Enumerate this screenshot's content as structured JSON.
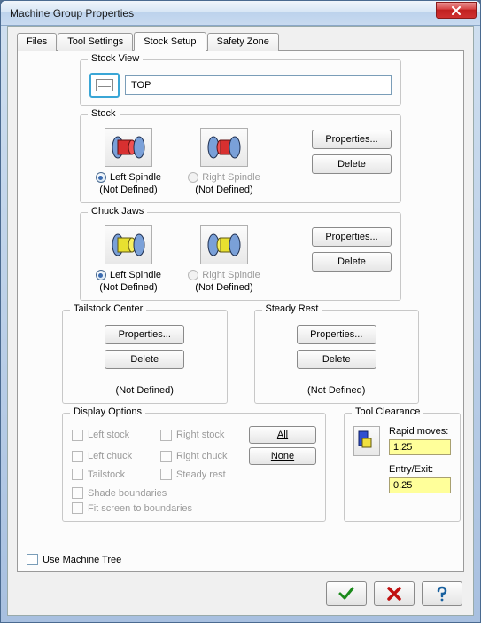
{
  "window": {
    "title": "Machine Group Properties"
  },
  "tabs": {
    "files": "Files",
    "tool_settings": "Tool Settings",
    "stock_setup": "Stock Setup",
    "safety_zone": "Safety Zone"
  },
  "stock_view": {
    "title": "Stock View",
    "value": "TOP"
  },
  "stock": {
    "title": "Stock",
    "left_spindle": "Left Spindle",
    "right_spindle": "Right Spindle",
    "left_status": "(Not Defined)",
    "right_status": "(Not Defined)",
    "properties_btn": "Properties...",
    "delete_btn": "Delete"
  },
  "chuck": {
    "title": "Chuck Jaws",
    "left_spindle": "Left Spindle",
    "right_spindle": "Right Spindle",
    "left_status": "(Not Defined)",
    "right_status": "(Not Defined)",
    "properties_btn": "Properties...",
    "delete_btn": "Delete"
  },
  "tailstock": {
    "title": "Tailstock Center",
    "properties_btn": "Properties...",
    "delete_btn": "Delete",
    "status": "(Not Defined)"
  },
  "steady": {
    "title": "Steady Rest",
    "properties_btn": "Properties...",
    "delete_btn": "Delete",
    "status": "(Not Defined)"
  },
  "display": {
    "title": "Display Options",
    "left_stock": "Left stock",
    "right_stock": "Right stock",
    "left_chuck": "Left chuck",
    "right_chuck": "Right chuck",
    "tailstock": "Tailstock",
    "steady_rest": "Steady rest",
    "all_btn": "All",
    "none_btn": "None",
    "shade": "Shade boundaries",
    "fit": "Fit screen to boundaries"
  },
  "tool_clearance": {
    "title": "Tool Clearance",
    "rapid_label": "Rapid moves:",
    "rapid_value": "1.25",
    "entry_label": "Entry/Exit:",
    "entry_value": "0.25"
  },
  "use_machine_tree": "Use Machine Tree"
}
